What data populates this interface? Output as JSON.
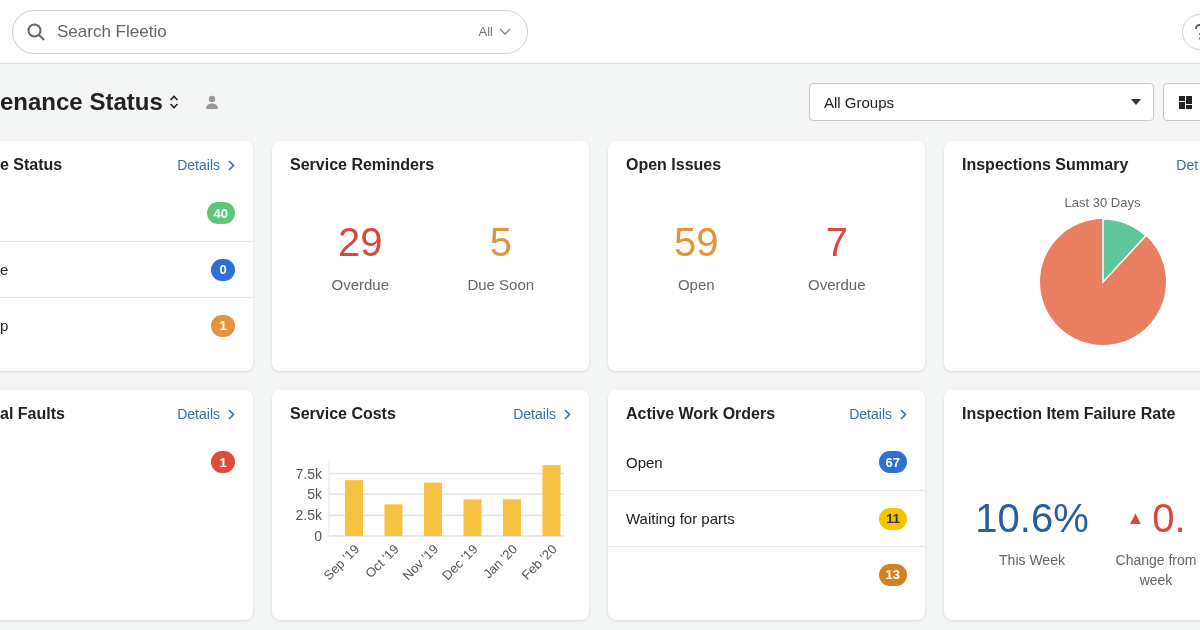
{
  "search": {
    "placeholder": "Search Fleetio",
    "scope": "All"
  },
  "header": {
    "title": "enance Status",
    "group_select": "All Groups"
  },
  "cards": [
    {
      "kind": "list",
      "title": "e Status",
      "link": "Details",
      "items": [
        {
          "count": "40",
          "color": "#5bc77a"
        },
        {
          "label": "e",
          "count": "0",
          "color": "#2d6fd2"
        },
        {
          "label": "p",
          "count": "1",
          "color": "#e0953a"
        }
      ]
    },
    {
      "kind": "stats",
      "title": "Service Reminders",
      "stats": [
        {
          "value": "29",
          "label": "Overdue",
          "color": "#d9483b"
        },
        {
          "value": "5",
          "label": "Due Soon",
          "color": "#e0953a"
        }
      ]
    },
    {
      "kind": "stats",
      "title": "Open Issues",
      "stats": [
        {
          "value": "59",
          "label": "Open",
          "color": "#e0953a"
        },
        {
          "value": "7",
          "label": "Overdue",
          "color": "#d9483b"
        }
      ]
    },
    {
      "kind": "pie",
      "title": "Inspections Summary",
      "link": "Det",
      "subtitle": "Last 30 Days"
    },
    {
      "kind": "list",
      "title": "al Faults",
      "link": "Details",
      "items": [
        {
          "count": "1",
          "color": "#e04b3c"
        }
      ]
    },
    {
      "kind": "chart",
      "title": "Service Costs",
      "link": "Details",
      "chart_data": {
        "type": "bar",
        "categories": [
          "Sep '19",
          "Oct '19",
          "Nov '19",
          "Dec '19",
          "Jan '20",
          "Feb '20"
        ],
        "grid": true,
        "ylim": [
          0,
          9000
        ],
        "yticks": [
          {
            "value": 0,
            "label": "0"
          },
          {
            "value": 2500,
            "label": "2.5k"
          },
          {
            "value": 5000,
            "label": "5k"
          },
          {
            "value": 7500,
            "label": "7.5k"
          }
        ],
        "series": [
          {
            "color": "#f5c242",
            "values": [
              6700,
              3800,
              6400,
              4400,
              4400,
              8500
            ]
          }
        ]
      }
    },
    {
      "kind": "list",
      "title": "Active Work Orders",
      "link": "Details",
      "items": [
        {
          "label": "Open",
          "count": "67",
          "color": "#2d6fd2"
        },
        {
          "label": "Waiting for parts",
          "count": "11",
          "color": "#f3c500"
        },
        {
          "count": "13",
          "color": "#d5801e"
        }
      ]
    },
    {
      "kind": "rate",
      "title": "Inspection Item Failure Rate",
      "metrics": [
        {
          "value": "10.6%",
          "label": "This Week",
          "color": "#2a5d9c"
        },
        {
          "arrow": "▲",
          "value": "0.",
          "label": "Change from\nweek",
          "color": "#d9483b"
        }
      ]
    }
  ]
}
